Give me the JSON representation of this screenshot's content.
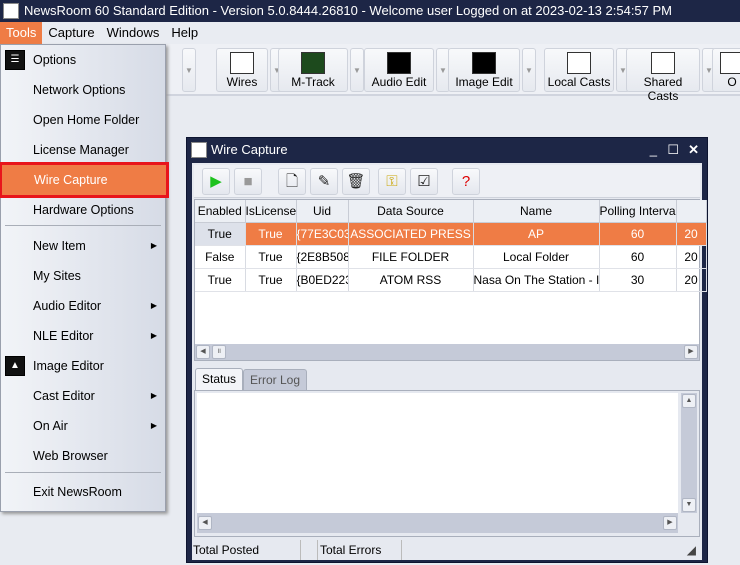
{
  "app": {
    "title": "NewsRoom 60 Standard Edition - Version 5.0.8444.26810 - Welcome user Logged on at 2023-02-13 2:54:57 PM",
    "logo": "klz"
  },
  "menubar": [
    {
      "label": "Tools",
      "active": true
    },
    {
      "label": "Capture"
    },
    {
      "label": "Windows"
    },
    {
      "label": "Help"
    }
  ],
  "toolbar": [
    {
      "label": "Wires",
      "icon": "wires-icon"
    },
    {
      "label": "M-Track",
      "icon": "mtrack-icon"
    },
    {
      "label": "Audio Edit",
      "icon": "audio-edit-icon"
    },
    {
      "label": "Image Edit",
      "icon": "image-edit-icon"
    },
    {
      "label": "Local Casts",
      "icon": "local-casts-icon"
    },
    {
      "label": "Shared Casts",
      "icon": "shared-casts-icon"
    },
    {
      "label": "O",
      "icon": "onair-icon"
    }
  ],
  "tools_menu": [
    {
      "label": "Options",
      "icon": "options-checklist-icon"
    },
    {
      "label": "Network Options"
    },
    {
      "label": "Open Home Folder"
    },
    {
      "label": "License Manager"
    },
    {
      "label": "Wire Capture",
      "selected": true
    },
    {
      "label": "Hardware Options"
    },
    {
      "label": "New Item",
      "submenu": true
    },
    {
      "label": "My Sites"
    },
    {
      "label": "Audio Editor",
      "submenu": true
    },
    {
      "label": "NLE Editor",
      "submenu": true
    },
    {
      "label": "Image Editor",
      "icon": "image-editor-icon"
    },
    {
      "label": "Cast Editor",
      "submenu": true
    },
    {
      "label": "On Air",
      "submenu": true
    },
    {
      "label": "Web Browser"
    },
    {
      "label": "Exit NewsRoom"
    }
  ],
  "wire_capture": {
    "title": "Wire Capture",
    "toolbar": [
      "play-icon",
      "stop-icon",
      "new-icon",
      "edit-icon",
      "delete-icon",
      "key-icon",
      "checklist-icon",
      "help-icon"
    ],
    "columns": [
      "Enabled",
      "IsLicense",
      "Uid",
      "Data Source",
      "Name",
      "Polling Interva",
      ""
    ],
    "rows": [
      [
        "True",
        "True",
        "{77E3C03",
        "ASSOCIATED PRESS",
        "AP",
        "60",
        "20"
      ],
      [
        "False",
        "True",
        "{2E8B508",
        "FILE FOLDER",
        "Local Folder",
        "60",
        "20"
      ],
      [
        "True",
        "True",
        "{B0ED223",
        "ATOM RSS",
        "Nasa On The Station - I",
        "30",
        "20"
      ]
    ],
    "selected_row": 0,
    "tabs": [
      {
        "label": "Status",
        "active": true
      },
      {
        "label": "Error Log"
      }
    ],
    "status_bar": {
      "total_posted": "Total Posted",
      "total_errors": "Total Errors"
    }
  },
  "colors": {
    "accent": "#ef7c45",
    "highlight_border": "#e8151b",
    "titlebar": "#1d2646"
  }
}
